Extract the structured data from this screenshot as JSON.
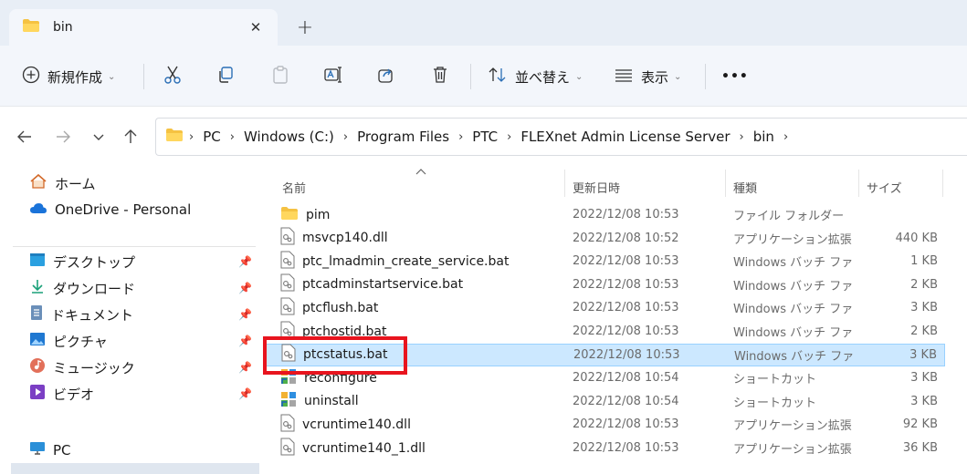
{
  "tab": {
    "title": "bin",
    "close_icon": "close-icon",
    "new_tab_icon": "plus-icon"
  },
  "toolbar": {
    "new_label": "新規作成",
    "sort_label": "並べ替え",
    "view_label": "表示",
    "more_label": "•••"
  },
  "breadcrumb": [
    "PC",
    "Windows (C:)",
    "Program Files",
    "PTC",
    "FLEXnet Admin License Server",
    "bin"
  ],
  "sidebar": {
    "top": [
      {
        "label": "ホーム",
        "icon": "home-icon"
      },
      {
        "label": "OneDrive - Personal",
        "icon": "cloud-icon"
      }
    ],
    "quick": [
      {
        "label": "デスクトップ",
        "icon": "desktop-icon"
      },
      {
        "label": "ダウンロード",
        "icon": "download-icon"
      },
      {
        "label": "ドキュメント",
        "icon": "document-icon"
      },
      {
        "label": "ピクチャ",
        "icon": "pictures-icon"
      },
      {
        "label": "ミュージック",
        "icon": "music-icon"
      },
      {
        "label": "ビデオ",
        "icon": "video-icon"
      }
    ],
    "pc": {
      "label": "PC",
      "icon": "pc-icon"
    }
  },
  "columns": {
    "name": "名前",
    "date": "更新日時",
    "type": "種類",
    "size": "サイズ"
  },
  "files": [
    {
      "name": "pim",
      "date": "2022/12/08 10:53",
      "type": "ファイル フォルダー",
      "size": "",
      "icon": "folder"
    },
    {
      "name": "msvcp140.dll",
      "date": "2022/12/08 10:52",
      "type": "アプリケーション拡張",
      "size": "440 KB",
      "icon": "dll"
    },
    {
      "name": "ptc_lmadmin_create_service.bat",
      "date": "2022/12/08 10:53",
      "type": "Windows バッチ ファ...",
      "size": "1 KB",
      "icon": "bat"
    },
    {
      "name": "ptcadminstartservice.bat",
      "date": "2022/12/08 10:53",
      "type": "Windows バッチ ファ...",
      "size": "2 KB",
      "icon": "bat"
    },
    {
      "name": "ptcflush.bat",
      "date": "2022/12/08 10:53",
      "type": "Windows バッチ ファ...",
      "size": "3 KB",
      "icon": "bat"
    },
    {
      "name": "ptchostid.bat",
      "date": "2022/12/08 10:53",
      "type": "Windows バッチ ファ...",
      "size": "2 KB",
      "icon": "bat"
    },
    {
      "name": "ptcstatus.bat",
      "date": "2022/12/08 10:53",
      "type": "Windows バッチ ファ...",
      "size": "3 KB",
      "icon": "bat",
      "selected": true
    },
    {
      "name": "reconfigure",
      "date": "2022/12/08 10:54",
      "type": "ショートカット",
      "size": "3 KB",
      "icon": "shortcut"
    },
    {
      "name": "uninstall",
      "date": "2022/12/08 10:54",
      "type": "ショートカット",
      "size": "3 KB",
      "icon": "shortcut"
    },
    {
      "name": "vcruntime140.dll",
      "date": "2022/12/08 10:53",
      "type": "アプリケーション拡張",
      "size": "92 KB",
      "icon": "dll"
    },
    {
      "name": "vcruntime140_1.dll",
      "date": "2022/12/08 10:53",
      "type": "アプリケーション拡張",
      "size": "36 KB",
      "icon": "dll"
    }
  ],
  "colors": {
    "selection": "#cce8ff",
    "highlight_box": "#e8141e",
    "folder": "#f5c242"
  }
}
